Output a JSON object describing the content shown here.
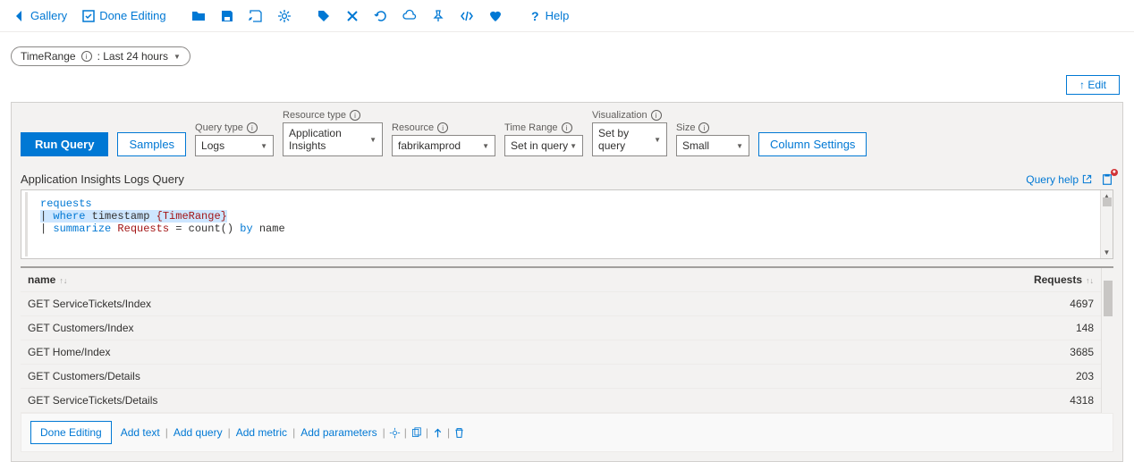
{
  "toolbar": {
    "gallery": "Gallery",
    "done_editing": "Done Editing",
    "help": "Help"
  },
  "param_pill": {
    "label": "TimeRange",
    "value": ": Last 24 hours"
  },
  "edit_button": "↑ Edit",
  "config": {
    "run_query": "Run Query",
    "samples": "Samples",
    "query_type": {
      "label": "Query type",
      "value": "Logs"
    },
    "resource_type": {
      "label": "Resource type",
      "value": "Application Insights"
    },
    "resource": {
      "label": "Resource",
      "value": "fabrikamprod"
    },
    "time_range": {
      "label": "Time Range",
      "value": "Set in query"
    },
    "visualization": {
      "label": "Visualization",
      "value": "Set by query"
    },
    "size": {
      "label": "Size",
      "value": "Small"
    },
    "column_settings": "Column Settings"
  },
  "query": {
    "title": "Application Insights Logs Query",
    "help": "Query help",
    "line1_table": "requests",
    "line2_pipe": "|",
    "line2_where": "where",
    "line2_ts": "timestamp",
    "line2_param": "{TimeRange}",
    "line3_pipe": "|",
    "line3_sum": "summarize",
    "line3_req": "Requests",
    "line3_eq": " = count() ",
    "line3_by": "by",
    "line3_name": " name"
  },
  "table": {
    "col_name": "name",
    "col_req": "Requests",
    "rows": [
      {
        "name": "GET ServiceTickets/Index",
        "req": "4697"
      },
      {
        "name": "GET Customers/Index",
        "req": "148"
      },
      {
        "name": "GET Home/Index",
        "req": "3685"
      },
      {
        "name": "GET Customers/Details",
        "req": "203"
      },
      {
        "name": "GET ServiceTickets/Details",
        "req": "4318"
      }
    ]
  },
  "bottom": {
    "done_editing": "Done Editing",
    "add_text": "Add text",
    "add_query": "Add query",
    "add_metric": "Add metric",
    "add_parameters": "Add parameters"
  }
}
